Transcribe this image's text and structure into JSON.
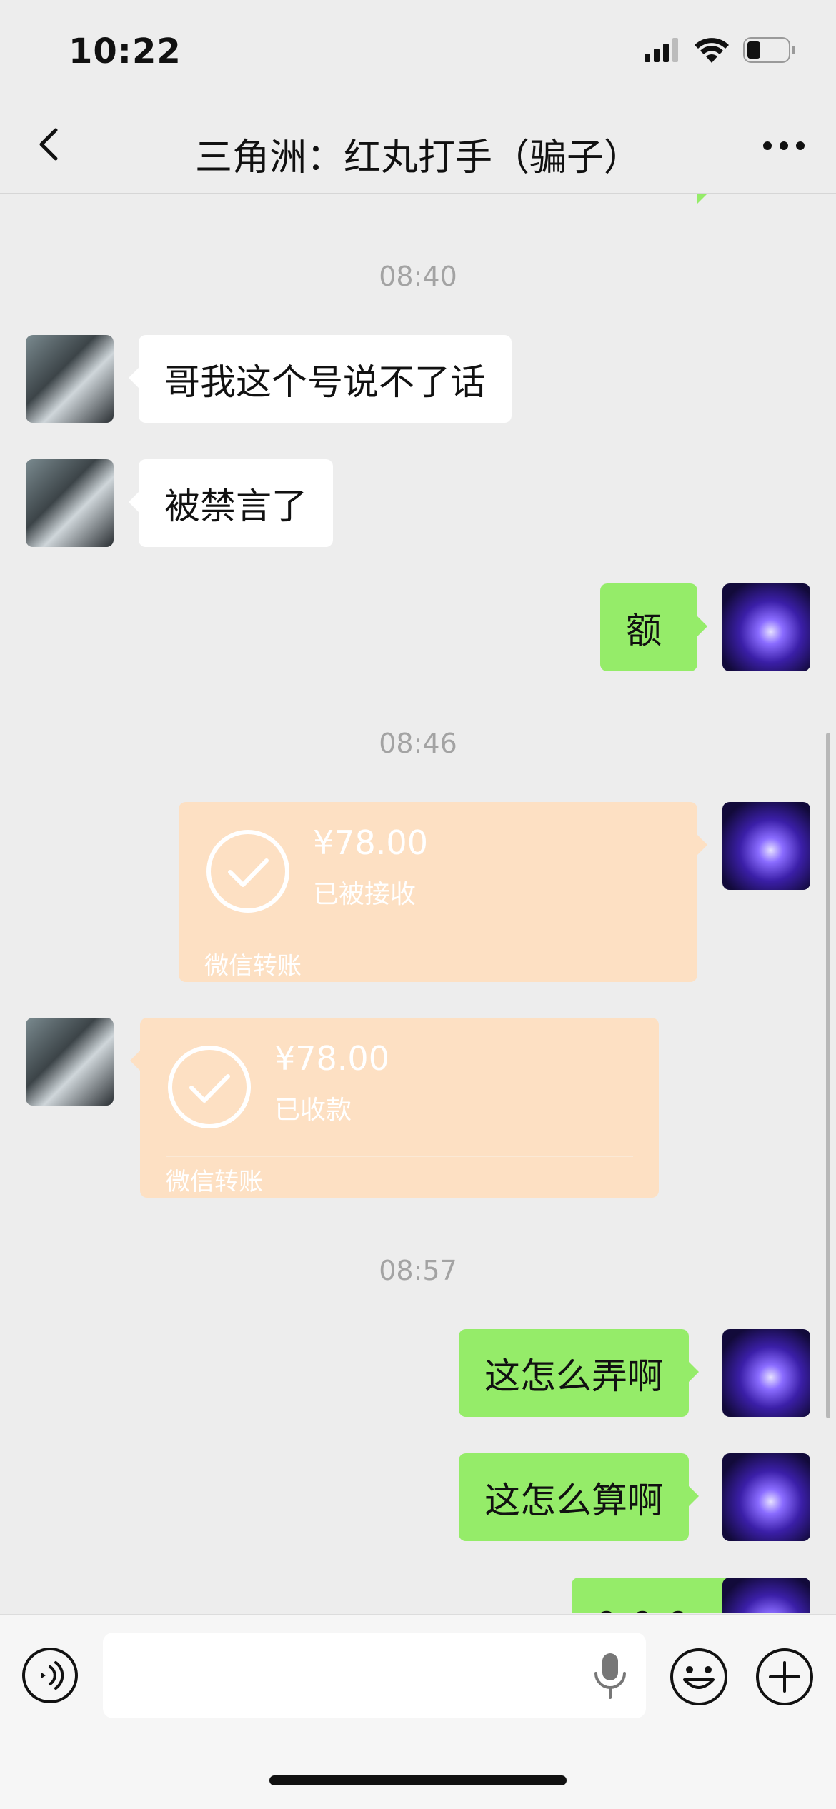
{
  "status_bar": {
    "time": "10:22"
  },
  "header": {
    "title": "三角洲：红丸打手（骗子）"
  },
  "messages": {
    "ts1": "08:40",
    "m1": "哥我这个号说不了话",
    "m2": "被禁言了",
    "m3": "额",
    "ts2": "08:46",
    "transfer_sent": {
      "amount": "¥78.00",
      "status": "已被接收",
      "label": "微信转账"
    },
    "transfer_received": {
      "amount": "¥78.00",
      "status": "已收款",
      "label": "微信转账"
    },
    "ts3": "08:57",
    "m4": "这怎么弄啊",
    "m5": "这怎么算啊",
    "m6": "？？？"
  },
  "input": {
    "value": "",
    "placeholder": ""
  },
  "colors": {
    "background": "#ededed",
    "outgoing_bubble": "#95ec69",
    "incoming_bubble": "#ffffff",
    "transfer_card": "#fde0c3"
  }
}
